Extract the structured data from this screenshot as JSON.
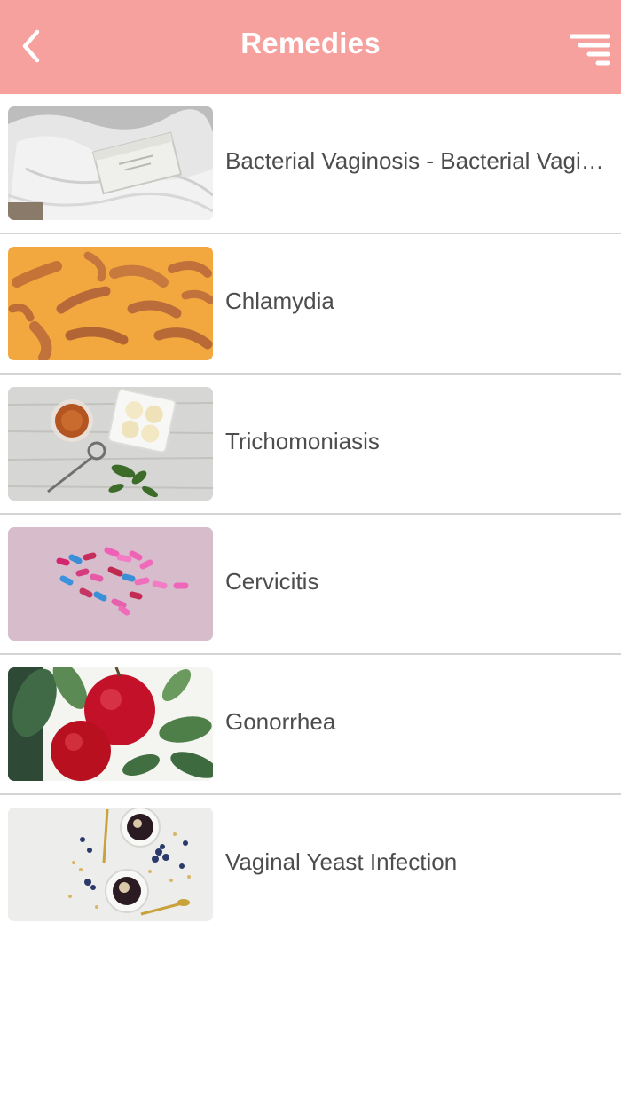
{
  "header": {
    "title": "Remedies",
    "background": "#f6a19e",
    "back_icon": "chevron-left-icon",
    "filter_icon": "filter-lines-icon"
  },
  "remedies": [
    {
      "label": "Bacterial Vaginosis - Bacterial Vaginosis",
      "image": "soap-bar-on-white-cloth"
    },
    {
      "label": "Chlamydia",
      "image": "turmeric-roots-on-orange"
    },
    {
      "label": "Trichomoniasis",
      "image": "tea-cup-and-cream-bowl"
    },
    {
      "label": "Cervicitis",
      "image": "colorful-pills-on-pink"
    },
    {
      "label": "Gonorrhea",
      "image": "red-apples-on-leaves"
    },
    {
      "label": "Vaginal Yeast Infection",
      "image": "dessert-cups-with-berries"
    }
  ]
}
